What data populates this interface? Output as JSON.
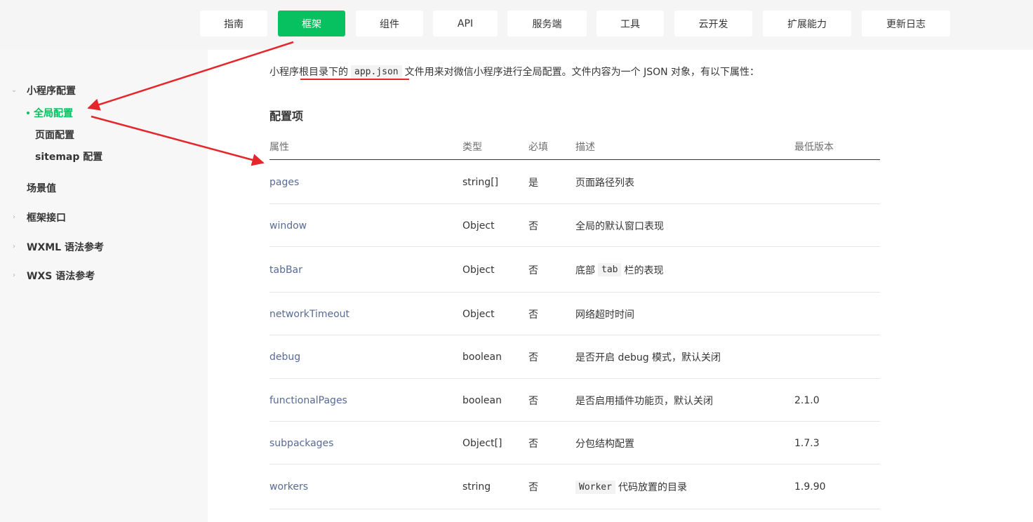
{
  "nav": {
    "tabs": [
      {
        "label": "指南",
        "active": false
      },
      {
        "label": "框架",
        "active": true
      },
      {
        "label": "组件",
        "active": false
      },
      {
        "label": "API",
        "active": false
      },
      {
        "label": "服务端",
        "active": false
      },
      {
        "label": "工具",
        "active": false
      },
      {
        "label": "云开发",
        "active": false
      },
      {
        "label": "扩展能力",
        "active": false
      },
      {
        "label": "更新日志",
        "active": false
      }
    ]
  },
  "sidebar": {
    "group": {
      "label": "小程序配置",
      "expanded": true,
      "icon": "chevron-down-icon"
    },
    "sub_items": [
      {
        "label": "全局配置",
        "active": true
      },
      {
        "label": "页面配置",
        "active": false
      },
      {
        "label": "sitemap 配置",
        "active": false
      }
    ],
    "items": [
      {
        "label": "场景值",
        "expandable": false
      },
      {
        "label": "框架接口",
        "expandable": true,
        "icon": "chevron-right-icon"
      },
      {
        "label": "WXML 语法参考",
        "expandable": true,
        "icon": "chevron-right-icon"
      },
      {
        "label": "WXS 语法参考",
        "expandable": true,
        "icon": "chevron-right-icon"
      }
    ]
  },
  "intro": {
    "before": "小程序根目录下的",
    "code": "app.json",
    "after": "文件用来对微信小程序进行全局配置。文件内容为一个 JSON 对象，有以下属性："
  },
  "section_title": "配置项",
  "table": {
    "headers": [
      "属性",
      "类型",
      "必填",
      "描述",
      "最低版本"
    ],
    "rows": [
      {
        "prop": "pages",
        "type": "string[]",
        "required": "是",
        "desc_pre": "页面路径列表",
        "desc_code": "",
        "desc_post": "",
        "version": ""
      },
      {
        "prop": "window",
        "type": "Object",
        "required": "否",
        "desc_pre": "全局的默认窗口表现",
        "desc_code": "",
        "desc_post": "",
        "version": ""
      },
      {
        "prop": "tabBar",
        "type": "Object",
        "required": "否",
        "desc_pre": "底部",
        "desc_code": "tab",
        "desc_post": "栏的表现",
        "version": ""
      },
      {
        "prop": "networkTimeout",
        "type": "Object",
        "required": "否",
        "desc_pre": "网络超时时间",
        "desc_code": "",
        "desc_post": "",
        "version": ""
      },
      {
        "prop": "debug",
        "type": "boolean",
        "required": "否",
        "desc_pre": "是否开启 debug 模式，默认关闭",
        "desc_code": "",
        "desc_post": "",
        "version": ""
      },
      {
        "prop": "functionalPages",
        "type": "boolean",
        "required": "否",
        "desc_pre": "是否启用插件功能页，默认关闭",
        "desc_code": "",
        "desc_post": "",
        "version": "2.1.0"
      },
      {
        "prop": "subpackages",
        "type": "Object[]",
        "required": "否",
        "desc_pre": "分包结构配置",
        "desc_code": "",
        "desc_post": "",
        "version": "1.7.3"
      },
      {
        "prop": "workers",
        "type": "string",
        "required": "否",
        "desc_pre": "",
        "desc_code": "Worker",
        "desc_post": "代码放置的目录",
        "version": "1.9.90"
      }
    ]
  },
  "colors": {
    "accent": "#07c160",
    "link": "#576b95",
    "annotation": "#e5262a"
  }
}
